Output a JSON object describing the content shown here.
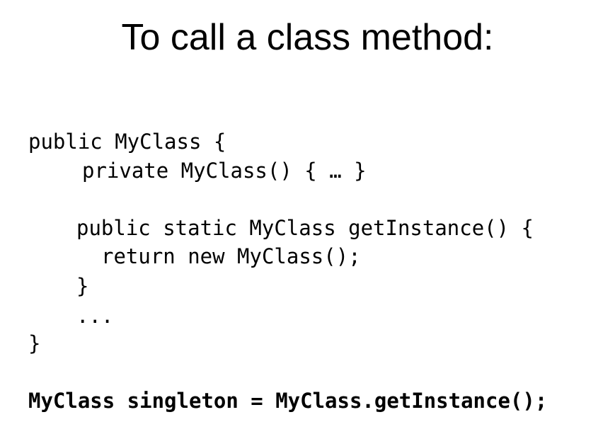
{
  "slide": {
    "title": "To call a class method:",
    "code_lines": [
      "public MyClass {",
      "private MyClass() { … }",
      "public static MyClass getInstance() {",
      "return new MyClass();",
      "}",
      "...",
      "}"
    ],
    "usage_line": "MyClass singleton = MyClass.getInstance();"
  }
}
